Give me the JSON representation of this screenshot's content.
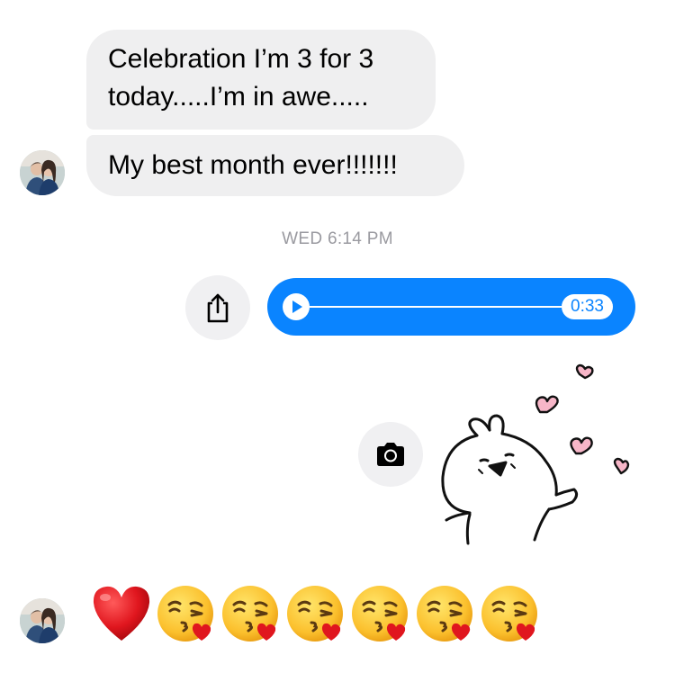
{
  "messages": [
    {
      "text": "Celebration I’m 3 for 3 today.....I’m in awe....."
    },
    {
      "text": "My best month ever!!!!!!!"
    }
  ],
  "timestamp": "WED 6:14 PM",
  "audio": {
    "duration": "0:33",
    "progress": 0
  },
  "icons": {
    "share": "share-icon",
    "camera": "camera-icon",
    "play": "play-icon",
    "avatar": "avatar",
    "sticker": "bunny-hearts-sticker"
  },
  "emoji_reaction": [
    "red-heart",
    "face-blowing-a-kiss",
    "face-blowing-a-kiss",
    "face-blowing-a-kiss",
    "face-blowing-a-kiss",
    "face-blowing-a-kiss",
    "face-blowing-a-kiss"
  ],
  "colors": {
    "incoming_bubble": "#efeff0",
    "outgoing_bubble": "#0a84ff",
    "timestamp": "#9a9aa0",
    "icon_button": "#f0f0f2"
  }
}
